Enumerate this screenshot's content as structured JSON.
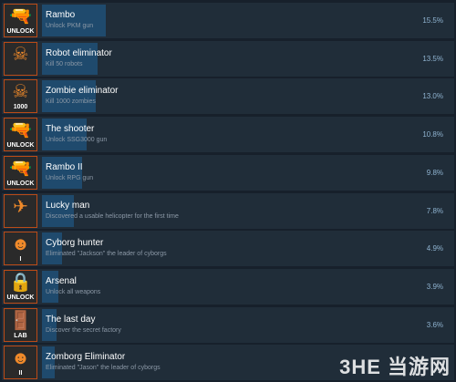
{
  "achievements": [
    {
      "title": "Rambo",
      "desc": "Unlock PKM gun",
      "percent": "15.5%",
      "pct": 15.5,
      "icon": "gun-icon",
      "icon_caption": "UNLOCK"
    },
    {
      "title": "Robot eliminator",
      "desc": "Kill 50 robots",
      "percent": "13.5%",
      "pct": 13.5,
      "icon": "robot-skull-icon",
      "icon_caption": ""
    },
    {
      "title": "Zombie eliminator",
      "desc": "Kill 1000 zombies",
      "percent": "13.0%",
      "pct": 13.0,
      "icon": "zombie-skull-icon",
      "icon_caption": "1000"
    },
    {
      "title": "The shooter",
      "desc": "Unlock SSG3000 gun",
      "percent": "10.8%",
      "pct": 10.8,
      "icon": "gun-icon",
      "icon_caption": "UNLOCK"
    },
    {
      "title": "Rambo II",
      "desc": "Unlock RPG gun",
      "percent": "9.8%",
      "pct": 9.8,
      "icon": "gun-icon",
      "icon_caption": "UNLOCK"
    },
    {
      "title": "Lucky man",
      "desc": "Discovered a usable helicopter for the first time",
      "percent": "7.8%",
      "pct": 7.8,
      "icon": "helicopter-icon",
      "icon_caption": ""
    },
    {
      "title": "Cyborg hunter",
      "desc": "Eliminated \"Jackson\" the leader of cyborgs",
      "percent": "4.9%",
      "pct": 4.9,
      "icon": "cyborg-icon",
      "icon_caption": "I"
    },
    {
      "title": "Arsenal",
      "desc": "Unlock all weapons",
      "percent": "3.9%",
      "pct": 3.9,
      "icon": "arsenal-icon",
      "icon_caption": "UNLOCK"
    },
    {
      "title": "The last day",
      "desc": "Discover the secret factory",
      "percent": "3.6%",
      "pct": 3.6,
      "icon": "lab-door-icon",
      "icon_caption": "LAB"
    },
    {
      "title": "Zomborg Eliminator",
      "desc": "Eliminated \"Jason\" the leader of cyborgs",
      "percent": "",
      "pct": 3.2,
      "icon": "cyborg-icon",
      "icon_caption": "II"
    }
  ],
  "max_pct": 15.5,
  "watermark": "3HE 当游网"
}
